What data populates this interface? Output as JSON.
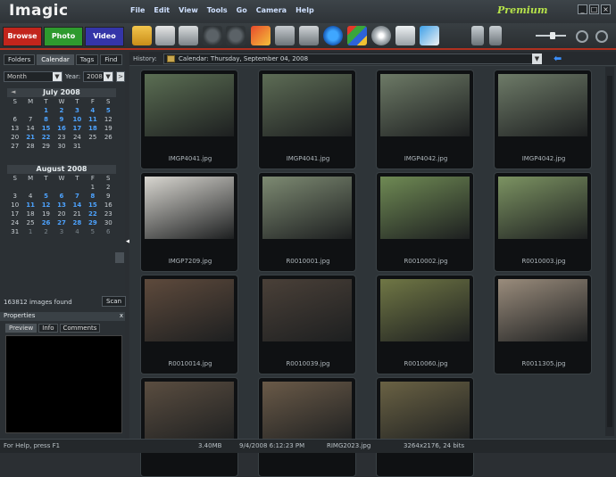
{
  "app": {
    "name": "Imagic",
    "edition": "Premium"
  },
  "menu": [
    "File",
    "Edit",
    "View",
    "Tools",
    "Go",
    "Camera",
    "Help"
  ],
  "modes": [
    {
      "label": "Browse",
      "color": "#c2251c"
    },
    {
      "label": "Photo",
      "color": "#2e9a2e"
    },
    {
      "label": "Video",
      "color": "#3435a8"
    }
  ],
  "toolbar_icons": [
    "open-folder-icon",
    "print-icon",
    "scanner-icon",
    "rotate-left-icon",
    "rotate-right-icon",
    "edit-icon",
    "crop-icon",
    "delete-icon",
    "refresh-icon",
    "slideshow-icon",
    "cd-burn-icon",
    "web-gallery-icon",
    "email-icon",
    "cart-add-icon",
    "cart-icon",
    "zoom-out-icon",
    "zoom-in-icon"
  ],
  "left_tabs": [
    "Folders",
    "Calendar",
    "Tags",
    "Find"
  ],
  "view_select": {
    "value": "Month",
    "year_label": "Year:",
    "year_value": "2008"
  },
  "calendars": [
    {
      "title": "July 2008",
      "dow": [
        "S",
        "M",
        "T",
        "W",
        "T",
        "F",
        "S"
      ],
      "rows": [
        [
          [
            "",
            ""
          ],
          [
            "",
            ""
          ],
          [
            "1",
            "mark"
          ],
          [
            "2",
            "mark"
          ],
          [
            "3",
            "mark"
          ],
          [
            "4",
            "mark"
          ],
          [
            "5",
            "mark"
          ]
        ],
        [
          [
            "6",
            ""
          ],
          [
            "7",
            ""
          ],
          [
            "8",
            "mark"
          ],
          [
            "9",
            "mark"
          ],
          [
            "10",
            "mark"
          ],
          [
            "11",
            "mark"
          ],
          [
            "12",
            ""
          ]
        ],
        [
          [
            "13",
            ""
          ],
          [
            "14",
            ""
          ],
          [
            "15",
            "mark"
          ],
          [
            "16",
            "mark"
          ],
          [
            "17",
            "mark"
          ],
          [
            "18",
            "mark"
          ],
          [
            "19",
            ""
          ]
        ],
        [
          [
            "20",
            ""
          ],
          [
            "21",
            "mark"
          ],
          [
            "22",
            "mark"
          ],
          [
            "23",
            ""
          ],
          [
            "24",
            ""
          ],
          [
            "25",
            ""
          ],
          [
            "26",
            ""
          ]
        ],
        [
          [
            "27",
            ""
          ],
          [
            "28",
            ""
          ],
          [
            "29",
            ""
          ],
          [
            "30",
            ""
          ],
          [
            "31",
            ""
          ],
          [
            "",
            ""
          ],
          [
            "",
            ""
          ]
        ]
      ]
    },
    {
      "title": "August 2008",
      "dow": [
        "S",
        "M",
        "T",
        "W",
        "T",
        "F",
        "S"
      ],
      "rows": [
        [
          [
            "",
            ""
          ],
          [
            "",
            ""
          ],
          [
            "",
            ""
          ],
          [
            "",
            ""
          ],
          [
            "",
            ""
          ],
          [
            "1",
            ""
          ],
          [
            "2",
            ""
          ]
        ],
        [
          [
            "3",
            ""
          ],
          [
            "4",
            ""
          ],
          [
            "5",
            "mark"
          ],
          [
            "6",
            "mark"
          ],
          [
            "7",
            "mark"
          ],
          [
            "8",
            "mark"
          ],
          [
            "9",
            ""
          ]
        ],
        [
          [
            "10",
            ""
          ],
          [
            "11",
            "mark"
          ],
          [
            "12",
            "mark"
          ],
          [
            "13",
            "mark"
          ],
          [
            "14",
            "mark"
          ],
          [
            "15",
            "mark"
          ],
          [
            "16",
            ""
          ]
        ],
        [
          [
            "17",
            ""
          ],
          [
            "18",
            ""
          ],
          [
            "19",
            ""
          ],
          [
            "20",
            ""
          ],
          [
            "21",
            ""
          ],
          [
            "22",
            "mark"
          ],
          [
            "23",
            ""
          ]
        ],
        [
          [
            "24",
            ""
          ],
          [
            "25",
            ""
          ],
          [
            "26",
            "mark"
          ],
          [
            "27",
            "mark"
          ],
          [
            "28",
            "mark"
          ],
          [
            "29",
            "mark"
          ],
          [
            "30",
            ""
          ]
        ],
        [
          [
            "31",
            ""
          ],
          [
            "1",
            "dim"
          ],
          [
            "2",
            "dim"
          ],
          [
            "3",
            "dim"
          ],
          [
            "4",
            "dim"
          ],
          [
            "5",
            "dim"
          ],
          [
            "6",
            "dim"
          ]
        ]
      ]
    }
  ],
  "images_found": "163812 images found",
  "scan_label": "Scan",
  "properties": {
    "title": "Properties",
    "close": "x",
    "tabs": [
      "Preview",
      "Info",
      "Comments"
    ]
  },
  "history": {
    "label": "History:",
    "value": "Calendar: Thursday, September 04, 2008"
  },
  "thumbnails": [
    {
      "name": "IMGP4041.jpg",
      "bg": "#5b6e53"
    },
    {
      "name": "IMGP4041.jpg",
      "bg": "#5d6c55"
    },
    {
      "name": "IMGP4042.jpg",
      "bg": "#6d7a66"
    },
    {
      "name": "IMGP4042.jpg",
      "bg": "#6e7b68"
    },
    {
      "name": "IMGP7209.jpg",
      "bg": "#d8d6d0"
    },
    {
      "name": "R0010001.jpg",
      "bg": "#7d8a72"
    },
    {
      "name": "R0010002.jpg",
      "bg": "#6f8a54"
    },
    {
      "name": "R0010003.jpg",
      "bg": "#7c9362"
    },
    {
      "name": "R0010014.jpg",
      "bg": "#5e4a3c"
    },
    {
      "name": "R0010039.jpg",
      "bg": "#4a4038"
    },
    {
      "name": "R0010060.jpg",
      "bg": "#707745"
    },
    {
      "name": "R0011305.jpg",
      "bg": "#9a8c7c"
    },
    {
      "name": "",
      "bg": "#5a4d40"
    },
    {
      "name": "",
      "bg": "#6a5a48"
    },
    {
      "name": "",
      "bg": "#6a6244"
    }
  ],
  "status": {
    "help": "For Help, press F1",
    "size": "3.40MB",
    "date": "9/4/2008 6:12:23 PM",
    "file": "RIMG2023.jpg",
    "dims": "3264x2176, 24 bits"
  }
}
